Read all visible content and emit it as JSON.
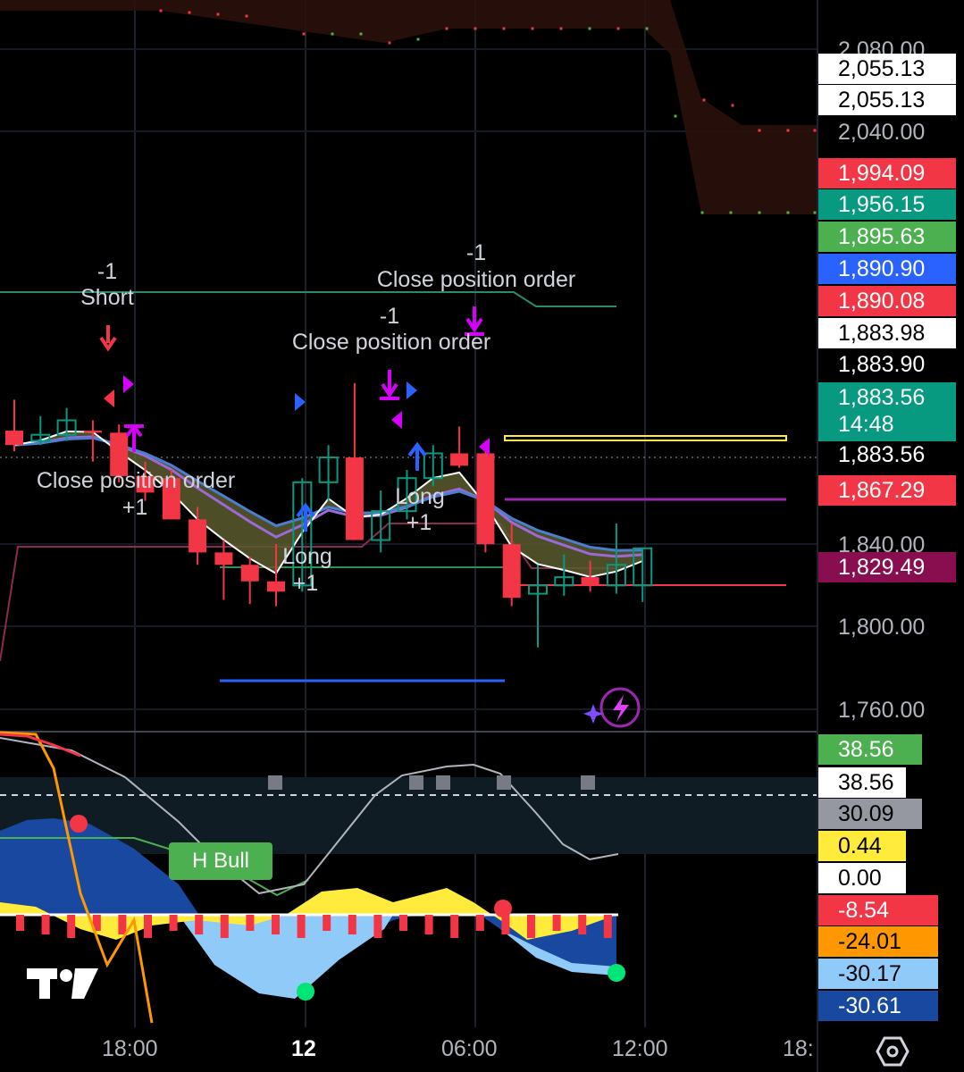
{
  "colors": {
    "up": "#089981",
    "down": "#f23645",
    "panel_fill": "#5b5a2f",
    "ma_white": "#ffffff",
    "ma_purple": "#9c6ad6",
    "ma_blue": "#4a7fd0",
    "cloud_dark": "#2a0f0c"
  },
  "price_axis": {
    "ticks": [
      "2,080.00",
      "2,040.00",
      "1,840.00",
      "1,800.00",
      "1,760.00"
    ],
    "current_price": "1,883.56"
  },
  "price_badges": [
    {
      "label": "2,055.13",
      "bg": "#ffffff",
      "fg": "#000000"
    },
    {
      "label": "2,055.13",
      "bg": "#ffffff",
      "fg": "#000000"
    },
    {
      "label": "1,994.09",
      "bg": "#f23645",
      "fg": "#ffffff"
    },
    {
      "label": "1,956.15",
      "bg": "#089981",
      "fg": "#ffffff"
    },
    {
      "label": "1,895.63",
      "bg": "#4caf50",
      "fg": "#ffffff"
    },
    {
      "label": "1,890.90",
      "bg": "#2962ff",
      "fg": "#ffffff"
    },
    {
      "label": "1,890.08",
      "bg": "#f23645",
      "fg": "#ffffff"
    },
    {
      "label": "1,883.98",
      "bg": "#ffffff",
      "fg": "#000000"
    },
    {
      "label": "1,883.90",
      "bg": "#000000",
      "fg": "#ffffff"
    },
    {
      "label": "1,867.29",
      "bg": "#f23645",
      "fg": "#ffffff"
    },
    {
      "label": "1,829.49",
      "bg": "#880e4f",
      "fg": "#ffffff"
    }
  ],
  "countdown_badge": {
    "price": "1,883.56",
    "time": "14:48",
    "bg": "#089981"
  },
  "indicator_badges": [
    {
      "label": "38.56",
      "bg": "#4caf50",
      "fg": "#ffffff"
    },
    {
      "label": "38.56",
      "bg": "#ffffff",
      "fg": "#000000"
    },
    {
      "label": "30.09",
      "bg": "#9598a1",
      "fg": "#000000"
    },
    {
      "label": "0.44",
      "bg": "#ffeb3b",
      "fg": "#000000"
    },
    {
      "label": "0.00",
      "bg": "#ffffff",
      "fg": "#000000"
    },
    {
      "label": "-8.54",
      "bg": "#f23645",
      "fg": "#ffffff"
    },
    {
      "label": "-24.01",
      "bg": "#ff9800",
      "fg": "#000000"
    },
    {
      "label": "-30.17",
      "bg": "#90caf9",
      "fg": "#000000"
    },
    {
      "label": "-30.61",
      "bg": "#1848a0",
      "fg": "#ffffff"
    }
  ],
  "time_axis": [
    "18:00",
    "12",
    "06:00",
    "12:00",
    "18:"
  ],
  "annotations": {
    "short_qty": "-1",
    "short_label": "Short",
    "close1_qty": "-1",
    "close1_label": "Close position order",
    "close2_qty": "-1",
    "close2_label": "Close position order",
    "close3_label": "Close position order",
    "close3_qty": "+1",
    "long1_label": "Long",
    "long1_qty": "+1",
    "long2_label": "Long",
    "long2_qty": "+1",
    "hbull": "H Bull"
  },
  "icons": [
    "tradingview-logo-icon",
    "settings-hexagon-icon",
    "sparkle-lightning-icon"
  ],
  "chart_data": [
    {
      "type": "candlestick",
      "title": "",
      "y_axis_ticks": [
        2080,
        2040,
        1840,
        1800,
        1760
      ],
      "x_axis_ticks": [
        "18:00",
        "12",
        "06:00",
        "12:00",
        "18:"
      ],
      "current_price": 1883.56,
      "candles": [
        {
          "o": 1895,
          "h": 1910,
          "l": 1885,
          "c": 1888
        },
        {
          "o": 1890,
          "h": 1902,
          "l": 1888,
          "c": 1893
        },
        {
          "o": 1893,
          "h": 1906,
          "l": 1890,
          "c": 1900
        },
        {
          "o": 1895,
          "h": 1900,
          "l": 1880,
          "c": 1894
        },
        {
          "o": 1894,
          "h": 1898,
          "l": 1870,
          "c": 1873
        },
        {
          "o": 1873,
          "h": 1880,
          "l": 1861,
          "c": 1865
        },
        {
          "o": 1872,
          "h": 1876,
          "l": 1852,
          "c": 1852
        },
        {
          "o": 1852,
          "h": 1858,
          "l": 1830,
          "c": 1836
        },
        {
          "o": 1836,
          "h": 1842,
          "l": 1813,
          "c": 1830
        },
        {
          "o": 1830,
          "h": 1834,
          "l": 1811,
          "c": 1822
        },
        {
          "o": 1822,
          "h": 1840,
          "l": 1810,
          "c": 1817
        },
        {
          "o": 1820,
          "h": 1872,
          "l": 1817,
          "c": 1870
        },
        {
          "o": 1870,
          "h": 1888,
          "l": 1861,
          "c": 1882
        },
        {
          "o": 1882,
          "h": 1918,
          "l": 1845,
          "c": 1842
        },
        {
          "o": 1842,
          "h": 1866,
          "l": 1836,
          "c": 1856
        },
        {
          "o": 1856,
          "h": 1876,
          "l": 1852,
          "c": 1872
        },
        {
          "o": 1872,
          "h": 1888,
          "l": 1868,
          "c": 1884
        },
        {
          "o": 1884,
          "h": 1897,
          "l": 1877,
          "c": 1878
        },
        {
          "o": 1884,
          "h": 1890,
          "l": 1836,
          "c": 1840
        },
        {
          "o": 1840,
          "h": 1850,
          "l": 1810,
          "c": 1814
        },
        {
          "o": 1816,
          "h": 1830,
          "l": 1790,
          "c": 1820
        },
        {
          "o": 1820,
          "h": 1835,
          "l": 1815,
          "c": 1824
        },
        {
          "o": 1824,
          "h": 1832,
          "l": 1817,
          "c": 1820
        },
        {
          "o": 1820,
          "h": 1850,
          "l": 1816,
          "c": 1830
        },
        {
          "o": 1820,
          "h": 1838,
          "l": 1812,
          "c": 1838
        }
      ]
    },
    {
      "type": "line",
      "title": "",
      "y_axis_values": [
        38.56,
        30.09,
        0.44,
        0.0,
        -8.54,
        -24.01,
        -30.17,
        -30.61
      ],
      "series": [
        {
          "values": [
            38.56,
            30.09,
            0.44,
            -8.54,
            -24.01,
            -30.17,
            -30.61
          ]
        }
      ]
    }
  ]
}
